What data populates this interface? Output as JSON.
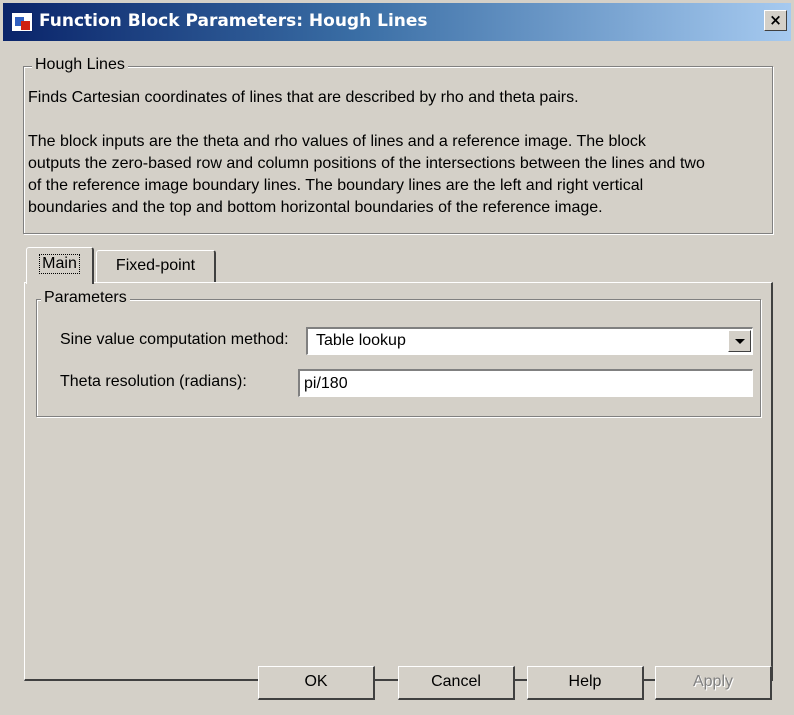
{
  "window": {
    "title": "Function Block Parameters: Hough Lines",
    "close_label": "×"
  },
  "block": {
    "group_title": "Hough Lines",
    "description_lines": [
      "Finds Cartesian coordinates of lines that are described by rho and theta pairs.",
      "",
      "The block inputs are the theta and rho values of lines and a reference image. The block",
      "outputs the zero-based row and column positions of the intersections between the lines and two",
      "of the reference image boundary lines. The boundary lines are the left and right vertical",
      "boundaries and the top and bottom horizontal boundaries of the reference image."
    ]
  },
  "tabs": [
    {
      "label": "Main",
      "selected": true
    },
    {
      "label": "Fixed-point",
      "selected": false
    }
  ],
  "parameters": {
    "group_title": "Parameters",
    "sine_method_label": "Sine value computation method:",
    "sine_method_value": "Table lookup",
    "theta_resolution_label": "Theta resolution (radians):",
    "theta_resolution_value": "pi/180"
  },
  "buttons": {
    "ok": "OK",
    "cancel": "Cancel",
    "help": "Help",
    "apply": "Apply"
  }
}
